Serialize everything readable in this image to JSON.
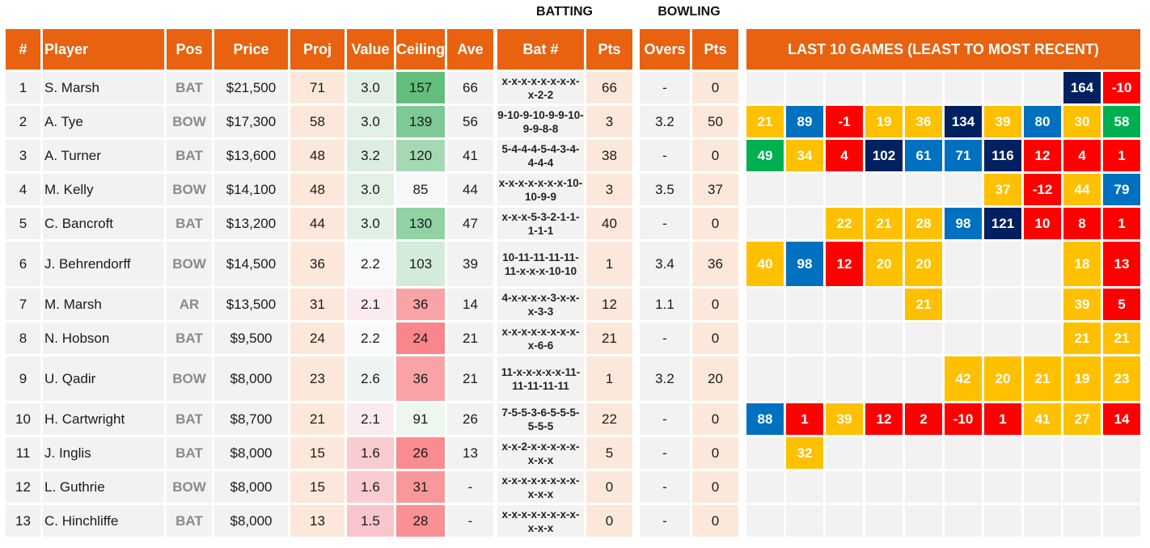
{
  "section_labels": {
    "batting": "BATTING",
    "bowling": "BOWLING"
  },
  "columns": {
    "num": "#",
    "player": "Player",
    "pos": "Pos",
    "price": "Price",
    "proj": "Proj",
    "value": "Value",
    "ceiling": "Ceiling",
    "ave": "Ave",
    "bat_num": "Bat #",
    "bat_pts": "Pts",
    "overs": "Overs",
    "bowl_pts": "Pts",
    "last10": "LAST 10 GAMES (LEAST TO MOST RECENT)"
  },
  "game_colors": {
    "yellow": "#ffc000",
    "blue": "#0070c0",
    "red": "#ff0000",
    "navy": "#002060",
    "green": "#00b050",
    "empty": "#f2f2f2"
  },
  "rows": [
    {
      "num": "1",
      "player": "S. Marsh",
      "pos": "BAT",
      "price": "$21,500",
      "proj": "71",
      "value": "3.0",
      "ceiling": "157",
      "ave": "66",
      "value_bg": "#e2f0e6",
      "ceiling_bg": "#63be7b",
      "bat_num": "x-x-x-x-x-x-x-x-x-2-2",
      "bat_pts": "66",
      "overs": "-",
      "bowl_pts": "0",
      "games": [
        null,
        null,
        null,
        null,
        null,
        null,
        null,
        null,
        {
          "v": "164",
          "c": "navy"
        },
        {
          "v": "-10",
          "c": "red"
        }
      ]
    },
    {
      "num": "2",
      "player": "A. Tye",
      "pos": "BOW",
      "price": "$17,300",
      "proj": "58",
      "value": "3.0",
      "ceiling": "139",
      "ave": "56",
      "value_bg": "#e2f0e6",
      "ceiling_bg": "#7ec994",
      "bat_num": "9-10-9-10-9-9-10-9-9-8-8",
      "bat_pts": "3",
      "overs": "3.2",
      "bowl_pts": "50",
      "games": [
        {
          "v": "21",
          "c": "yellow"
        },
        {
          "v": "89",
          "c": "blue"
        },
        {
          "v": "-1",
          "c": "red"
        },
        {
          "v": "19",
          "c": "yellow"
        },
        {
          "v": "36",
          "c": "yellow"
        },
        {
          "v": "134",
          "c": "navy"
        },
        {
          "v": "39",
          "c": "yellow"
        },
        {
          "v": "80",
          "c": "blue"
        },
        {
          "v": "30",
          "c": "yellow"
        },
        {
          "v": "58",
          "c": "green"
        }
      ]
    },
    {
      "num": "3",
      "player": "A. Turner",
      "pos": "BAT",
      "price": "$13,600",
      "proj": "48",
      "value": "3.2",
      "ceiling": "120",
      "ave": "41",
      "value_bg": "#dcede1",
      "ceiling_bg": "#a5d9b3",
      "bat_num": "5-4-4-4-5-4-3-4-4-4-4",
      "bat_pts": "38",
      "overs": "-",
      "bowl_pts": "0",
      "games": [
        {
          "v": "49",
          "c": "green"
        },
        {
          "v": "34",
          "c": "yellow"
        },
        {
          "v": "4",
          "c": "red"
        },
        {
          "v": "102",
          "c": "navy"
        },
        {
          "v": "61",
          "c": "blue"
        },
        {
          "v": "71",
          "c": "blue"
        },
        {
          "v": "116",
          "c": "navy"
        },
        {
          "v": "12",
          "c": "red"
        },
        {
          "v": "4",
          "c": "red"
        },
        {
          "v": "1",
          "c": "red"
        }
      ]
    },
    {
      "num": "4",
      "player": "M. Kelly",
      "pos": "BOW",
      "price": "$14,100",
      "proj": "48",
      "value": "3.0",
      "ceiling": "85",
      "ave": "44",
      "value_bg": "#e2f0e6",
      "ceiling_bg": "#f8f8fb",
      "bat_num": "x-x-x-x-x-x-x-10-10-9-9",
      "bat_pts": "3",
      "overs": "3.5",
      "bowl_pts": "37",
      "games": [
        null,
        null,
        null,
        null,
        null,
        null,
        {
          "v": "37",
          "c": "yellow"
        },
        {
          "v": "-12",
          "c": "red"
        },
        {
          "v": "44",
          "c": "yellow"
        },
        {
          "v": "79",
          "c": "blue"
        }
      ]
    },
    {
      "num": "5",
      "player": "C. Bancroft",
      "pos": "BAT",
      "price": "$13,200",
      "proj": "44",
      "value": "3.0",
      "ceiling": "130",
      "ave": "47",
      "value_bg": "#e2f0e6",
      "ceiling_bg": "#92d1a4",
      "bat_num": "x-x-x-5-3-2-1-1-1-1-1",
      "bat_pts": "40",
      "overs": "-",
      "bowl_pts": "0",
      "games": [
        null,
        null,
        {
          "v": "22",
          "c": "yellow"
        },
        {
          "v": "21",
          "c": "yellow"
        },
        {
          "v": "28",
          "c": "yellow"
        },
        {
          "v": "98",
          "c": "blue"
        },
        {
          "v": "121",
          "c": "navy"
        },
        {
          "v": "10",
          "c": "red"
        },
        {
          "v": "8",
          "c": "red"
        },
        {
          "v": "1",
          "c": "red"
        }
      ]
    },
    {
      "num": "6",
      "player": "J. Behrendorff",
      "pos": "BOW",
      "price": "$14,500",
      "proj": "36",
      "value": "2.2",
      "ceiling": "103",
      "ave": "39",
      "value_bg": "#f8f9fb",
      "ceiling_bg": "#d3ebd9",
      "bat_num": "10-11-11-11-11-11-x-x-x-10-10",
      "bat_pts": "1",
      "overs": "3.4",
      "bowl_pts": "36",
      "games": [
        {
          "v": "40",
          "c": "yellow"
        },
        {
          "v": "98",
          "c": "blue"
        },
        {
          "v": "12",
          "c": "red"
        },
        {
          "v": "20",
          "c": "yellow"
        },
        {
          "v": "20",
          "c": "yellow"
        },
        null,
        null,
        null,
        {
          "v": "18",
          "c": "yellow"
        },
        {
          "v": "13",
          "c": "red"
        }
      ]
    },
    {
      "num": "7",
      "player": "M. Marsh",
      "pos": "AR",
      "price": "$13,500",
      "proj": "31",
      "value": "2.1",
      "ceiling": "36",
      "ave": "14",
      "value_bg": "#fcebee",
      "ceiling_bg": "#f9a3a6",
      "bat_num": "4-x-x-x-x-3-x-x-x-3-3",
      "bat_pts": "12",
      "overs": "1.1",
      "bowl_pts": "0",
      "games": [
        null,
        null,
        null,
        null,
        {
          "v": "21",
          "c": "yellow"
        },
        null,
        null,
        null,
        {
          "v": "39",
          "c": "yellow"
        },
        {
          "v": "5",
          "c": "red"
        }
      ]
    },
    {
      "num": "8",
      "player": "N. Hobson",
      "pos": "BAT",
      "price": "$9,500",
      "proj": "24",
      "value": "2.2",
      "ceiling": "24",
      "ave": "21",
      "value_bg": "#f8f9fb",
      "ceiling_bg": "#f8868a",
      "bat_num": "x-x-x-x-x-x-x-x-x-6-6",
      "bat_pts": "21",
      "overs": "-",
      "bowl_pts": "0",
      "games": [
        null,
        null,
        null,
        null,
        null,
        null,
        null,
        null,
        {
          "v": "21",
          "c": "yellow"
        },
        {
          "v": "21",
          "c": "yellow"
        }
      ]
    },
    {
      "num": "9",
      "player": "U. Qadir",
      "pos": "BOW",
      "price": "$8,000",
      "proj": "23",
      "value": "2.6",
      "ceiling": "36",
      "ave": "21",
      "value_bg": "#eef5f1",
      "ceiling_bg": "#f9a3a6",
      "bat_num": "11-x-x-x-x-x-11-11-11-11-11",
      "bat_pts": "1",
      "overs": "3.2",
      "bowl_pts": "20",
      "games": [
        null,
        null,
        null,
        null,
        null,
        {
          "v": "42",
          "c": "yellow"
        },
        {
          "v": "20",
          "c": "yellow"
        },
        {
          "v": "21",
          "c": "yellow"
        },
        {
          "v": "19",
          "c": "yellow"
        },
        {
          "v": "23",
          "c": "yellow"
        }
      ]
    },
    {
      "num": "10",
      "player": "H. Cartwright",
      "pos": "BAT",
      "price": "$8,700",
      "proj": "21",
      "value": "2.1",
      "ceiling": "91",
      "ave": "26",
      "value_bg": "#fcebee",
      "ceiling_bg": "#eef6f0",
      "bat_num": "7-5-5-3-6-5-5-5-5-5-5",
      "bat_pts": "22",
      "overs": "-",
      "bowl_pts": "0",
      "games": [
        {
          "v": "88",
          "c": "blue"
        },
        {
          "v": "1",
          "c": "red"
        },
        {
          "v": "39",
          "c": "yellow"
        },
        {
          "v": "12",
          "c": "red"
        },
        {
          "v": "2",
          "c": "red"
        },
        {
          "v": "-10",
          "c": "red"
        },
        {
          "v": "1",
          "c": "red"
        },
        {
          "v": "41",
          "c": "yellow"
        },
        {
          "v": "27",
          "c": "yellow"
        },
        {
          "v": "14",
          "c": "red"
        }
      ]
    },
    {
      "num": "11",
      "player": "J. Inglis",
      "pos": "BAT",
      "price": "$8,000",
      "proj": "15",
      "value": "1.6",
      "ceiling": "26",
      "ave": "13",
      "value_bg": "#f9ccd0",
      "ceiling_bg": "#f88c90",
      "bat_num": "x-x-2-x-x-x-x-x-x-x-x",
      "bat_pts": "5",
      "overs": "-",
      "bowl_pts": "0",
      "games": [
        null,
        {
          "v": "32",
          "c": "yellow"
        },
        null,
        null,
        null,
        null,
        null,
        null,
        null,
        null
      ]
    },
    {
      "num": "12",
      "player": "L. Guthrie",
      "pos": "BOW",
      "price": "$8,000",
      "proj": "15",
      "value": "1.6",
      "ceiling": "31",
      "ave": "-",
      "value_bg": "#f9ccd0",
      "ceiling_bg": "#f9989b",
      "bat_num": "x-x-x-x-x-x-x-x-x-x-x",
      "bat_pts": "0",
      "overs": "-",
      "bowl_pts": "0",
      "games": [
        null,
        null,
        null,
        null,
        null,
        null,
        null,
        null,
        null,
        null
      ]
    },
    {
      "num": "13",
      "player": "C. Hinchliffe",
      "pos": "BAT",
      "price": "$8,000",
      "proj": "13",
      "value": "1.5",
      "ceiling": "28",
      "ave": "-",
      "value_bg": "#f8c6ca",
      "ceiling_bg": "#f89094",
      "bat_num": "x-x-x-x-x-x-x-x-x-x-x",
      "bat_pts": "0",
      "overs": "-",
      "bowl_pts": "0",
      "games": [
        null,
        null,
        null,
        null,
        null,
        null,
        null,
        null,
        null,
        null
      ]
    }
  ]
}
